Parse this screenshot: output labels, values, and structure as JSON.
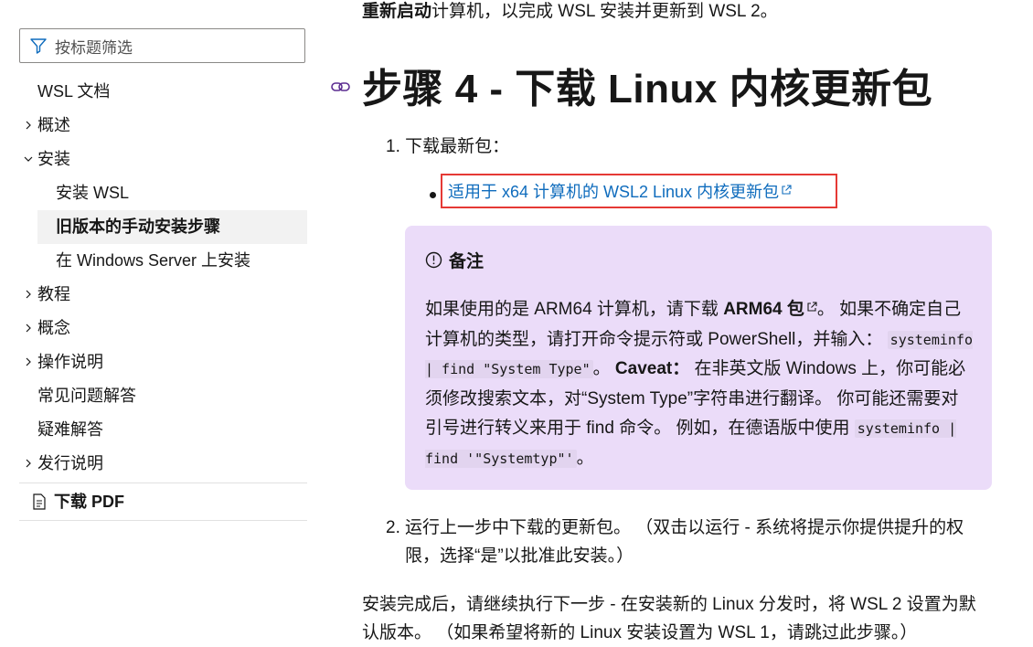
{
  "sidebar": {
    "filter_placeholder": "按标题筛选",
    "items": [
      {
        "label": "WSL 文档",
        "level": 0,
        "expander": "none"
      },
      {
        "label": "概述",
        "level": 0,
        "expander": "collapsed"
      },
      {
        "label": "安装",
        "level": 0,
        "expander": "expanded"
      },
      {
        "label": "安装 WSL",
        "level": 1,
        "expander": "none"
      },
      {
        "label": "旧版本的手动安装步骤",
        "level": 1,
        "expander": "none",
        "active": true
      },
      {
        "label": "在 Windows Server 上安装",
        "level": 1,
        "expander": "none"
      },
      {
        "label": "教程",
        "level": 0,
        "expander": "collapsed"
      },
      {
        "label": "概念",
        "level": 0,
        "expander": "collapsed"
      },
      {
        "label": "操作说明",
        "level": 0,
        "expander": "collapsed"
      },
      {
        "label": "常见问题解答",
        "level": 0,
        "expander": "none"
      },
      {
        "label": "疑难解答",
        "level": 0,
        "expander": "none"
      },
      {
        "label": "发行说明",
        "level": 0,
        "expander": "collapsed"
      }
    ],
    "download_pdf": "下载 PDF"
  },
  "main": {
    "intro_bold": "重新启动",
    "intro_rest": "计算机，以完成 WSL 安装并更新到 WSL 2。",
    "heading": "步骤 4 - 下载 Linux 内核更新包",
    "step1_num": "1.",
    "step1": "下载最新包：",
    "download_link": "适用于 x64 计算机的 WSL2 Linux 内核更新包",
    "note": {
      "title": "备注",
      "p1": "如果使用的是 ARM64 计算机，请下载 ",
      "arm_link": "ARM64 包",
      "p2": "。 如果不确定自己计算机的类型，请打开命令提示符或 PowerShell，并输入：",
      "code1": "systeminfo | find \"System Type\"",
      "p3": "。 ",
      "caveat": "Caveat：",
      "p4": " 在非英文版 Windows 上，你可能必须修改搜索文本，对“System Type”字符串进行翻译。 你可能还需要对引号进行转义来用于 find 命令。 例如，在德语版中使用 ",
      "code2": "systeminfo | find '\"Systemtyp\"'",
      "p5": "。"
    },
    "step2_num": "2.",
    "step2": "运行上一步中下载的更新包。 （双击以运行 - 系统将提示你提供提升的权限，选择“是”以批准此安装。）",
    "after": "安装完成后，请继续执行下一步 - 在安装新的 Linux 分发时，将 WSL 2 设置为默认版本。 （如果希望将新的 Linux 安装设置为 WSL 1，请跳过此步骤。）"
  },
  "colors": {
    "link": "#0f6cbd",
    "note_bg": "#ebdcf9",
    "highlight_border": "#e53935",
    "active_bg": "#f2f2f2"
  }
}
